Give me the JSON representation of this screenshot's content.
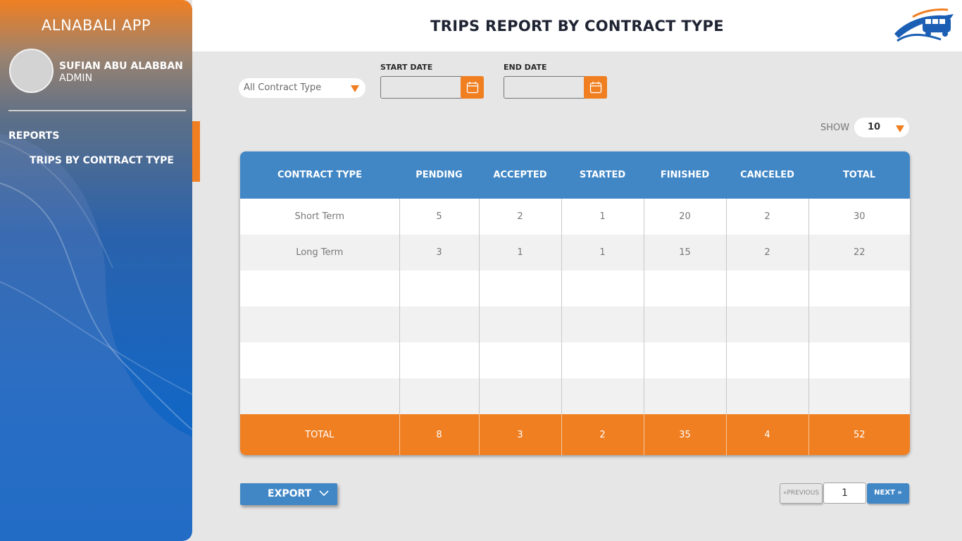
{
  "sidebar": {
    "app_name": "ALNABALI APP",
    "user_name": "SUFIAN ABU ALABBAN",
    "user_role": "ADMIN",
    "section_label": "REPORTS",
    "nav_items": [
      {
        "label": "TRIPS BY CONTRACT TYPE",
        "active": true
      }
    ]
  },
  "header": {
    "title": "TRIPS REPORT BY CONTRACT TYPE",
    "logo_icon": "bus-logo-icon"
  },
  "filters": {
    "contract_type": {
      "value": "All Contract Type"
    },
    "start_date": {
      "label": "START DATE",
      "value": ""
    },
    "end_date": {
      "label": "END DATE",
      "value": ""
    },
    "calendar_icon": "calendar-icon"
  },
  "show": {
    "label": "SHOW",
    "value": "10"
  },
  "table": {
    "columns": [
      "CONTRACT TYPE",
      "PENDING",
      "ACCEPTED",
      "STARTED",
      "FINISHED",
      "CANCELED",
      "TOTAL"
    ],
    "rows": [
      [
        "Short Term",
        "5",
        "2",
        "1",
        "20",
        "2",
        "30"
      ],
      [
        "Long Term",
        "3",
        "1",
        "1",
        "15",
        "2",
        "22"
      ],
      [
        "",
        "",
        "",
        "",
        "",
        "",
        ""
      ],
      [
        "",
        "",
        "",
        "",
        "",
        "",
        ""
      ],
      [
        "",
        "",
        "",
        "",
        "",
        "",
        ""
      ],
      [
        "",
        "",
        "",
        "",
        "",
        "",
        ""
      ]
    ],
    "totals": [
      "TOTAL",
      "8",
      "3",
      "2",
      "35",
      "4",
      "52"
    ]
  },
  "export": {
    "label": "EXPORT"
  },
  "pagination": {
    "previous_label": "PREVIOUS",
    "page": "1",
    "next_label": "NEXT"
  },
  "colors": {
    "accent_orange": "#f07f22",
    "header_blue": "#4187c6",
    "sidebar_blue": "#1566c3",
    "background": "#e6e6e6"
  }
}
